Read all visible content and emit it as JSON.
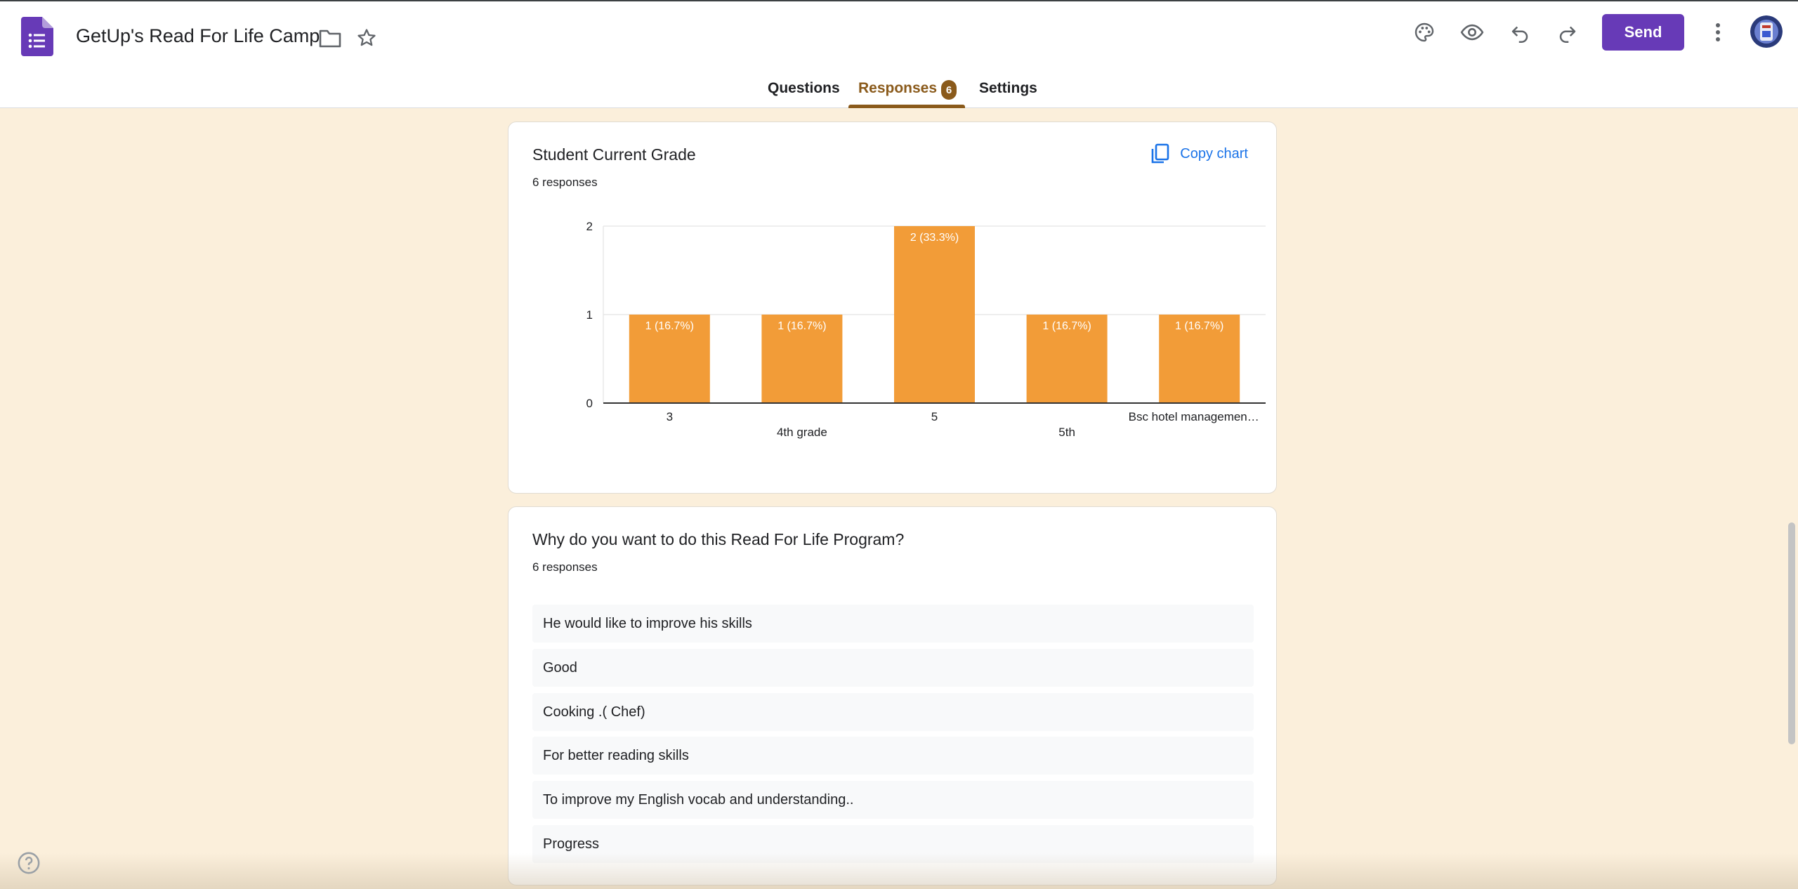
{
  "header": {
    "title": "GetUp's Read For Life Camp",
    "send_label": "Send",
    "brand_color": "#673ab7",
    "icons": [
      "forms-logo-icon",
      "folder-icon",
      "star-icon",
      "palette-icon",
      "preview-eye-icon",
      "undo-icon",
      "redo-icon",
      "more-vert-icon",
      "avatar"
    ]
  },
  "tabs": [
    {
      "label": "Questions",
      "active": false
    },
    {
      "label": "Responses",
      "active": true,
      "badge": "6"
    },
    {
      "label": "Settings",
      "active": false
    }
  ],
  "chart_card": {
    "title": "Student Current Grade",
    "responses": "6 responses",
    "copy_label": "Copy chart",
    "accent_color": "#f29c38"
  },
  "chart_data": {
    "type": "bar",
    "categories": [
      "3",
      "4th grade",
      "5",
      "5th",
      "Bsc hotel managemen…"
    ],
    "values": [
      1,
      1,
      2,
      1,
      1
    ],
    "labels": [
      "1 (16.7%)",
      "1 (16.7%)",
      "2 (33.3%)",
      "1 (16.7%)",
      "1 (16.7%)"
    ],
    "yticks": [
      "0",
      "1",
      "2"
    ],
    "ylim": [
      0,
      2
    ],
    "grid": true,
    "color": "#f29c38"
  },
  "text_card": {
    "title": "Why do you want to do this Read For Life Program?",
    "responses": "6 responses",
    "items": [
      "He would like to improve his skills",
      "Good",
      "Cooking .( Chef)",
      "For better reading skills",
      "To improve my English vocab and understanding..",
      "Progress"
    ]
  }
}
